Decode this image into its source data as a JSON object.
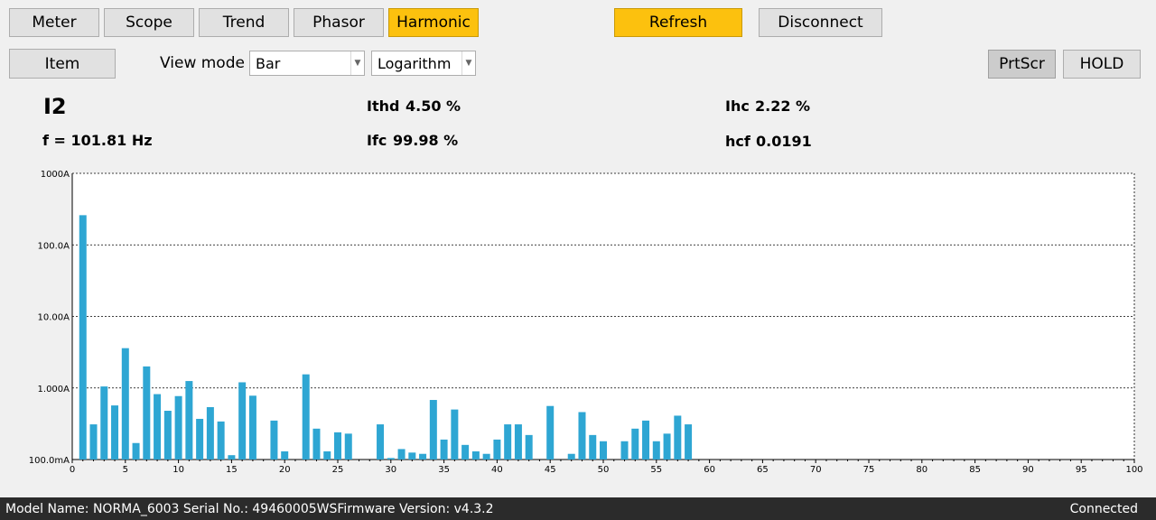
{
  "tabs": [
    {
      "label": "Meter",
      "active": false
    },
    {
      "label": "Scope",
      "active": false
    },
    {
      "label": "Trend",
      "active": false
    },
    {
      "label": "Phasor",
      "active": false
    },
    {
      "label": "Harmonic",
      "active": true
    }
  ],
  "actions": {
    "refresh": "Refresh",
    "disconnect": "Disconnect"
  },
  "toolbar": {
    "item": "Item",
    "view_mode_label": "View mode",
    "view_mode_value": "Bar",
    "scale_value": "Logarithm",
    "prtscr": "PrtScr",
    "hold": "HOLD"
  },
  "readings": {
    "channel": "I2",
    "freq": "f = 101.81 Hz",
    "ithd_label": "Ithd",
    "ithd_value": "4.50 %",
    "ifc_label": "Ifc",
    "ifc_value": "99.98 %",
    "ihc_label": "Ihc",
    "ihc_value": "2.22 %",
    "hcf_label": "hcf",
    "hcf_value": "0.0191"
  },
  "chart_data": {
    "type": "bar",
    "xlabel": "",
    "ylabel": "",
    "yscale": "log",
    "ylim": [
      0.1,
      1000
    ],
    "xlim": [
      0,
      100
    ],
    "y_ticks": [
      "100.0mA",
      "1.000A",
      "10.00A",
      "100.0A",
      "1000A"
    ],
    "x_ticks": [
      "0",
      "5",
      "10",
      "15",
      "20",
      "25",
      "30",
      "35",
      "40",
      "45",
      "50",
      "55",
      "60",
      "65",
      "70",
      "75",
      "80",
      "85",
      "90",
      "95",
      "100"
    ],
    "grid": true,
    "bar_color": "#2ea6d3",
    "x": [
      1,
      2,
      3,
      4,
      5,
      6,
      7,
      8,
      9,
      10,
      11,
      12,
      13,
      14,
      15,
      16,
      17,
      18,
      19,
      20,
      21,
      22,
      23,
      24,
      25,
      26,
      27,
      28,
      29,
      30,
      31,
      32,
      33,
      34,
      35,
      36,
      37,
      38,
      39,
      40,
      41,
      42,
      43,
      44,
      45,
      46,
      47,
      48,
      49,
      50,
      51,
      52,
      53,
      54,
      55,
      56,
      57,
      58
    ],
    "values": [
      260,
      0.31,
      1.05,
      0.57,
      3.6,
      0.17,
      2.0,
      0.82,
      0.48,
      0.77,
      1.25,
      0.37,
      0.54,
      0.34,
      0.115,
      1.2,
      0.78,
      0.1,
      0.35,
      0.13,
      0.1,
      1.55,
      0.27,
      0.13,
      0.24,
      0.23,
      0.1,
      0.1,
      0.31,
      0.105,
      0.14,
      0.125,
      0.12,
      0.68,
      0.19,
      0.5,
      0.16,
      0.13,
      0.12,
      0.19,
      0.31,
      0.31,
      0.22,
      0.1,
      0.56,
      0.1,
      0.12,
      0.46,
      0.22,
      0.18,
      0.1,
      0.18,
      0.27,
      0.35,
      0.18,
      0.23,
      0.41,
      0.31
    ]
  },
  "status": {
    "model": "Model Name:  NORMA_6003 Serial No.:  49460005WSFirmware Version:  v4.3.2",
    "connection": "Connected"
  }
}
